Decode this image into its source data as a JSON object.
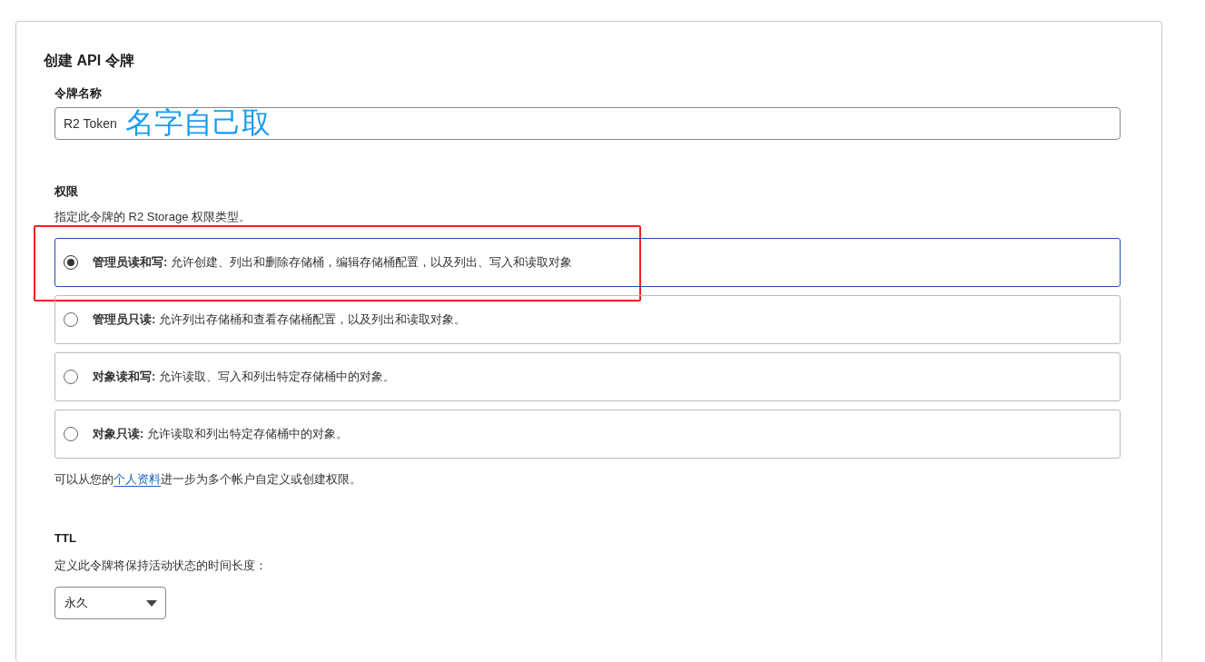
{
  "title": "创建 API 令牌",
  "name_field": {
    "label": "令牌名称",
    "value": "R2 Token",
    "annotation": "名字自己取"
  },
  "permissions": {
    "label": "权限",
    "description": "指定此令牌的 R2 Storage 权限类型。",
    "options": [
      {
        "name": "管理员读和写:",
        "text": "允许创建、列出和删除存储桶，编辑存储桶配置，以及列出、写入和读取对象",
        "selected": true,
        "highlighted": true
      },
      {
        "name": "管理员只读:",
        "text": "允许列出存储桶和查看存储桶配置，以及列出和读取对象。",
        "selected": false,
        "highlighted": false
      },
      {
        "name": "对象读和写:",
        "text": "允许读取、写入和列出特定存储桶中的对象。",
        "selected": false,
        "highlighted": false
      },
      {
        "name": "对象只读:",
        "text": "允许读取和列出特定存储桶中的对象。",
        "selected": false,
        "highlighted": false
      }
    ],
    "footer": {
      "before": "可以从您的",
      "link": "个人资料",
      "after": "进一步为多个帐户自定义或创建权限。"
    }
  },
  "ttl": {
    "label": "TTL",
    "description": "定义此令牌将保持活动状态的时间长度：",
    "value": "永久"
  }
}
